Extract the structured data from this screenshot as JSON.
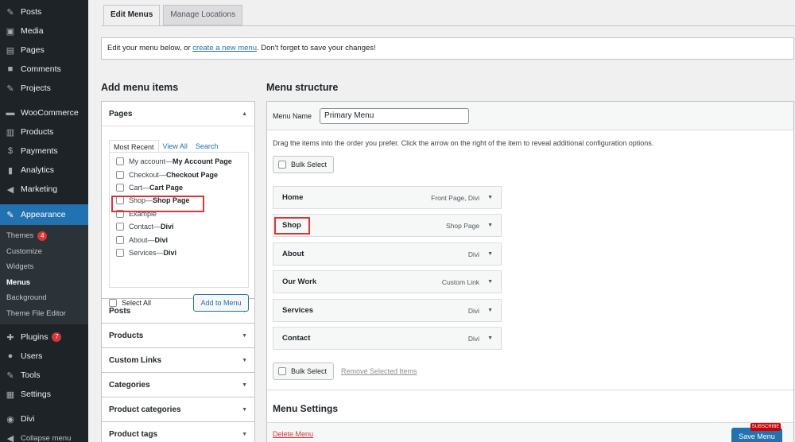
{
  "sidebar": {
    "items": [
      {
        "label": "Posts",
        "icon": "pin-icon"
      },
      {
        "label": "Media",
        "icon": "media-icon"
      },
      {
        "label": "Pages",
        "icon": "page-icon"
      },
      {
        "label": "Comments",
        "icon": "comment-icon"
      },
      {
        "label": "Projects",
        "icon": "pin-icon"
      }
    ],
    "items2": [
      {
        "label": "WooCommerce",
        "icon": "woo-icon"
      },
      {
        "label": "Products",
        "icon": "archive-icon"
      },
      {
        "label": "Payments",
        "icon": "dollar-icon"
      },
      {
        "label": "Analytics",
        "icon": "chart-icon"
      },
      {
        "label": "Marketing",
        "icon": "megaphone-icon"
      }
    ],
    "appearance": "Appearance",
    "sub": {
      "themes": "Themes",
      "themes_badge": "4",
      "customize": "Customize",
      "widgets": "Widgets",
      "menus": "Menus",
      "background": "Background",
      "theme_file_editor": "Theme File Editor"
    },
    "plugins": "Plugins",
    "plugins_badge": "7",
    "users": "Users",
    "tools": "Tools",
    "settings": "Settings",
    "divi": "Divi",
    "collapse": "Collapse menu"
  },
  "tabs": {
    "edit": "Edit Menus",
    "manage": "Manage Locations"
  },
  "notice": {
    "pre": "Edit your menu below, or ",
    "link": "create a new menu",
    "post": ". Don't forget to save your changes!"
  },
  "add_items": {
    "title": "Add menu items",
    "pages": {
      "title": "Pages",
      "tabs": {
        "most_recent": "Most Recent",
        "view_all": "View All",
        "search": "Search"
      },
      "list": [
        {
          "name": "My account",
          "tag": "My Account Page"
        },
        {
          "name": "Checkout",
          "tag": "Checkout Page"
        },
        {
          "name": "Cart",
          "tag": "Cart Page"
        },
        {
          "name": "Shop",
          "tag": "Shop Page"
        },
        {
          "name": "Example",
          "tag": ""
        },
        {
          "name": "Contact",
          "tag": "Divi"
        },
        {
          "name": "About",
          "tag": "Divi"
        },
        {
          "name": "Services",
          "tag": "Divi"
        }
      ],
      "sep": " — ",
      "select_all": "Select All",
      "add_button": "Add to Menu"
    },
    "sections": [
      "Posts",
      "Products",
      "Custom Links",
      "Categories",
      "Product categories",
      "Product tags"
    ]
  },
  "structure": {
    "title": "Menu structure",
    "menu_name_label": "Menu Name",
    "menu_name_value": "Primary Menu",
    "instructions": "Drag the items into the order you prefer. Click the arrow on the right of the item to reveal additional configuration options.",
    "bulk_select": "Bulk Select",
    "remove_selected": "Remove Selected Items",
    "items": [
      {
        "label": "Home",
        "type": "Front Page, Divi"
      },
      {
        "label": "Shop",
        "type": "Shop Page"
      },
      {
        "label": "About",
        "type": "Divi"
      },
      {
        "label": "Our Work",
        "type": "Custom Link"
      },
      {
        "label": "Services",
        "type": "Divi"
      },
      {
        "label": "Contact",
        "type": "Divi"
      }
    ],
    "settings_title": "Menu Settings",
    "delete": "Delete Menu",
    "save": "Save Menu"
  },
  "overlay": {
    "subscribe": "SUBSCRIBE"
  },
  "colors": {
    "accent": "#2271b1",
    "sidebar": "#1d2327",
    "highlight": "#d63638"
  }
}
